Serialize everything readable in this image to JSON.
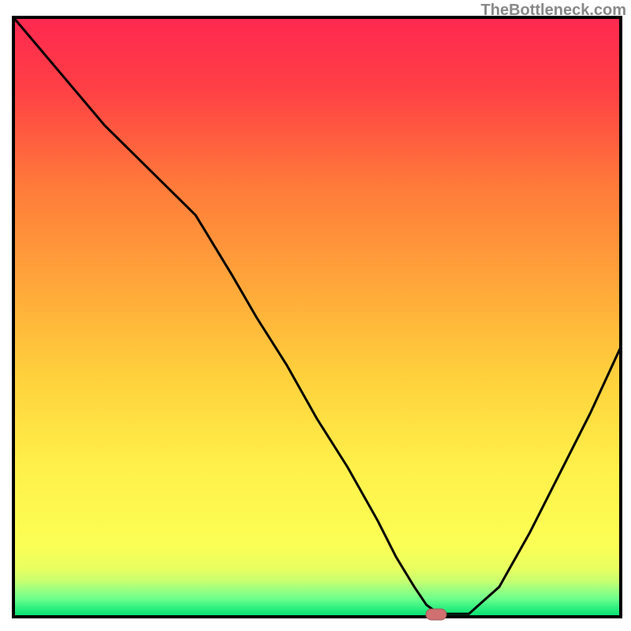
{
  "watermark": "TheBottleneck.com",
  "chart_data": {
    "type": "line",
    "title": "",
    "xlabel": "",
    "ylabel": "",
    "x_range": [
      0,
      100
    ],
    "y_range": [
      0,
      100
    ],
    "series": [
      {
        "name": "curve",
        "x": [
          0,
          5,
          10,
          15,
          20,
          25,
          30,
          33,
          36,
          40,
          45,
          50,
          55,
          60,
          63,
          66,
          68,
          70,
          75,
          80,
          85,
          90,
          95,
          100
        ],
        "y": [
          100,
          94,
          88,
          82,
          77,
          72,
          67,
          62,
          57,
          50,
          42,
          33,
          25,
          16,
          10,
          5,
          2,
          0.5,
          0.5,
          5,
          14,
          24,
          34,
          45
        ]
      }
    ],
    "optimal_point": {
      "x": 69,
      "y": 0.5
    },
    "background_gradient": {
      "top": "#ff2850",
      "mid_upper": "#ff7a3a",
      "mid": "#ffc93c",
      "mid_lower": "#fff04a",
      "green_band_top": "#f7ff60",
      "green_band": "#6cff8c",
      "bottom_green": "#00e070"
    },
    "frame_color": "#000000",
    "marker_fill": "#d07070",
    "marker_stroke": "#a05858"
  }
}
